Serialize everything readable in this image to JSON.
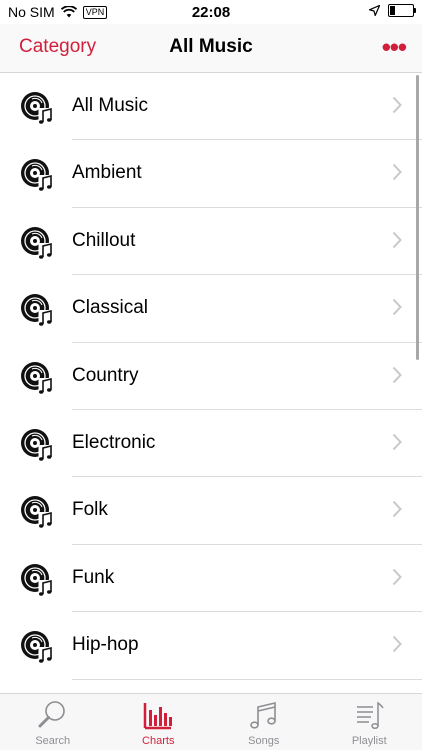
{
  "status": {
    "carrier": "No SIM",
    "vpn": "VPN",
    "time": "22:08",
    "battery_level": 0.25
  },
  "nav": {
    "back_label": "Category",
    "title": "All Music",
    "more_label": "•••"
  },
  "categories": [
    {
      "label": "All Music"
    },
    {
      "label": "Ambient"
    },
    {
      "label": "Chillout"
    },
    {
      "label": "Classical"
    },
    {
      "label": "Country"
    },
    {
      "label": "Electronic"
    },
    {
      "label": "Folk"
    },
    {
      "label": "Funk"
    },
    {
      "label": "Hip-hop"
    }
  ],
  "tabs": [
    {
      "label": "Search",
      "icon": "search-icon",
      "active": false
    },
    {
      "label": "Charts",
      "icon": "charts-icon",
      "active": true
    },
    {
      "label": "Songs",
      "icon": "music-note-icon",
      "active": false
    },
    {
      "label": "Playlist",
      "icon": "playlist-icon",
      "active": false
    }
  ],
  "colors": {
    "accent": "#d11f3b",
    "inactive": "#8e8e93"
  }
}
